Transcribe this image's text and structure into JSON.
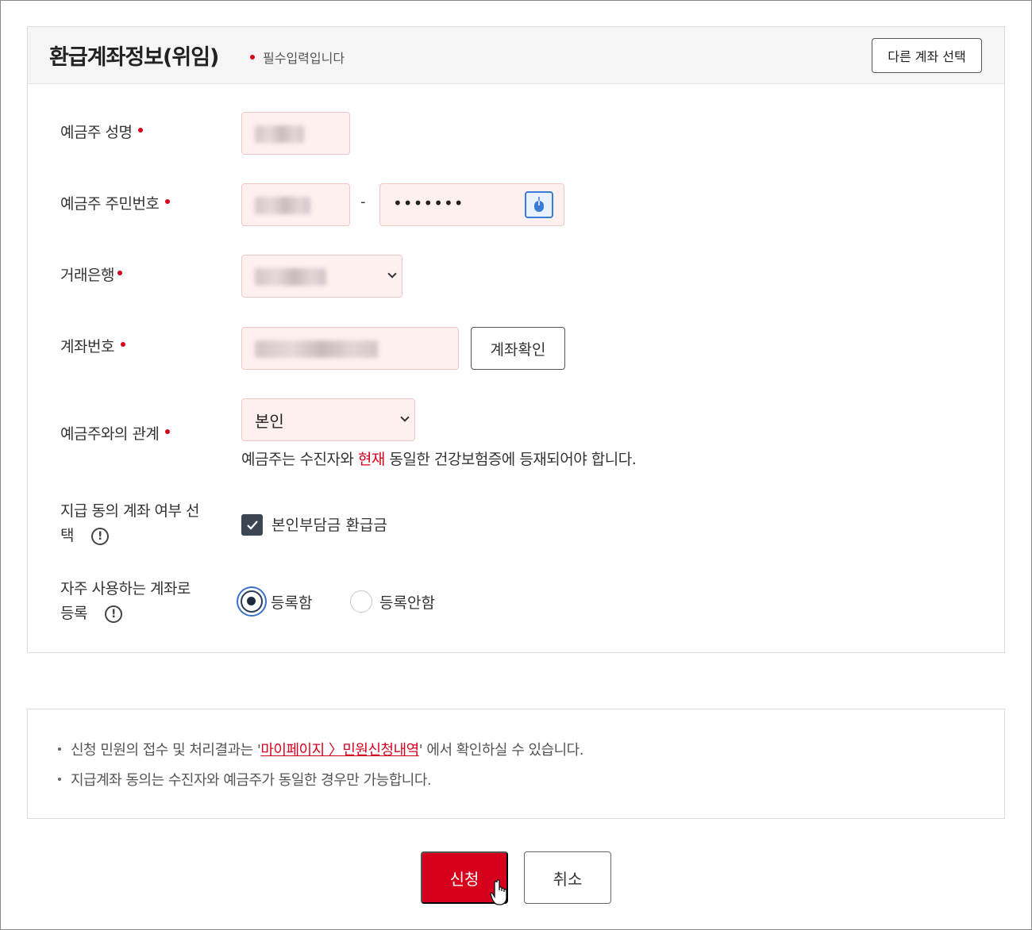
{
  "header": {
    "title": "환급계좌정보(위임)",
    "required_note": "필수입력입니다",
    "other_account_button": "다른 계좌 선택"
  },
  "form": {
    "holder_name_label": "예금주 성명",
    "holder_id_label": "예금주 주민번호",
    "id_separator": "-",
    "id_back_masked": "•••••••",
    "bank_label": "거래은행",
    "account_label": "계좌번호",
    "verify_button": "계좌확인",
    "relation_label": "예금주와의 관계",
    "relation_selected": "본인",
    "hint_prefix": "예금주는 수진자와 ",
    "hint_accent": "현재",
    "hint_suffix": " 동일한 건강보험증에 등재되어야 합니다.",
    "consent_label": "지급 동의 계좌 여부 선택",
    "consent_line1": "지급 동의 계좌 여부 선",
    "consent_line2": "택",
    "consent_checkbox_label": "본인부담금 환급금",
    "consent_checked": true,
    "favorite_line1": "자주 사용하는 계좌로",
    "favorite_line2": "등록",
    "favorite_options": [
      "등록함",
      "등록안함"
    ],
    "favorite_selected": "등록함"
  },
  "notice": {
    "item1_prefix": "신청 민원의 접수 및 처리결과는 '",
    "item1_link": "마이페이지 〉민원신청내역",
    "item1_suffix": "' 에서 확인하실 수 있습니다.",
    "item2": "지급계좌 동의는 수진자와 예금주가 동일한 경우만 가능합니다."
  },
  "actions": {
    "submit": "신청",
    "cancel": "취소"
  },
  "colors": {
    "accent": "#d6001c",
    "field_bg": "#fff0f0",
    "header_bg": "#f5f5f5"
  },
  "icons": {
    "required": "red-dot",
    "info": "info-icon",
    "keyboard": "secure-keypad-icon",
    "cursor": "hand-cursor-icon"
  }
}
